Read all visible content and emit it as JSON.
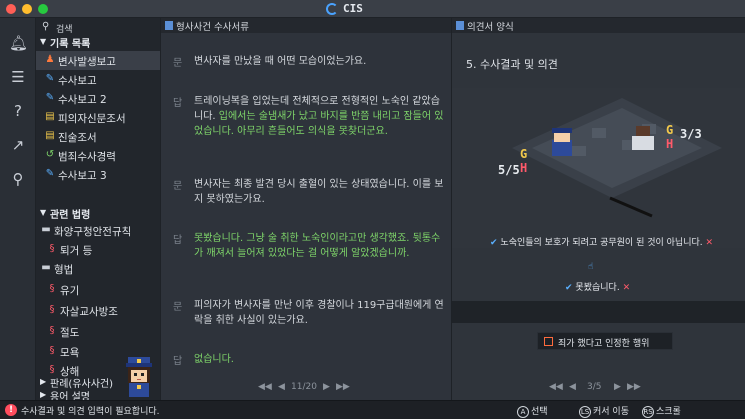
{
  "window": {
    "title": "CIS"
  },
  "search": {
    "label": "검색"
  },
  "nav": {
    "section1": "기록 목록",
    "records": [
      {
        "label": "변사발생보고",
        "icon": "person-red-icon"
      },
      {
        "label": "수사보고",
        "icon": "pen-icon"
      },
      {
        "label": "수사보고 2",
        "icon": "pen-icon"
      },
      {
        "label": "피의자신문조서",
        "icon": "document-yellow-icon"
      },
      {
        "label": "진술조서",
        "icon": "document-yellow-icon"
      },
      {
        "label": "범죄수사경력",
        "icon": "history-green-icon"
      },
      {
        "label": "수사보고 3",
        "icon": "pen-icon"
      }
    ],
    "section2": "관련 법령",
    "laws": [
      {
        "label": "화양구청안전규칙",
        "icon": "folder-icon"
      },
      {
        "label": "퇴거 등",
        "icon": "section-icon"
      },
      {
        "label": "형법",
        "icon": "folder-icon"
      },
      {
        "label": "유기",
        "icon": "section-icon"
      },
      {
        "label": "자살교사방조",
        "icon": "section-icon"
      },
      {
        "label": "절도",
        "icon": "section-icon"
      },
      {
        "label": "모욕",
        "icon": "section-icon"
      },
      {
        "label": "상해",
        "icon": "section-icon"
      }
    ],
    "section3": "판례(유사사건)",
    "section4": "용어 설명"
  },
  "middle": {
    "header": "형사사건 수사서류",
    "qa": [
      {
        "mark": "문",
        "text": "변사자를 만났을 때 어떤 모습이었는가요.",
        "green": ""
      },
      {
        "mark": "답",
        "text": "트레이닝복을 입었는데 전체적으로 전형적인 노숙인 같았습니다.",
        "green": "입에서는 술냄새가 났고 바지를 반쯤 내리고 잠들어 있었습니다. 아무리 흔들어도 의식을 못찾더군요."
      },
      {
        "mark": "문",
        "text": "변사자는 최종 발견 당시 출혈이 있는 상태였습니다. 이를 보지 못하였는가요.",
        "green": ""
      },
      {
        "mark": "답",
        "text": "",
        "green": "못봤습니다. 그냥 술 취한 노숙인이라고만 생각했죠. 뒷통수가 깨져서 늘어져 있었다는 걸 어떻게 알았겠습니까."
      },
      {
        "mark": "문",
        "text": "피의자가 변사자를 만난 이후 경찰이나 119구급대원에게 연락을 취한 사실이 있는가요.",
        "green": ""
      },
      {
        "mark": "답",
        "text": "",
        "green": "없습니다."
      }
    ],
    "pager": {
      "page": "11/20"
    }
  },
  "right": {
    "header": "의견서 양식",
    "section_title": "5. 수사결과 및 의견",
    "option1": "노숙인들의 보호가 되려고 공무원이 된 것이 아닙니다.",
    "option2": "못봤습니다.",
    "result": "죄가 했다고 인정한 행위",
    "pager": {
      "page": "3/5"
    }
  },
  "status": {
    "message": "수사결과 및 의견 입력이 필요합니다.",
    "hints": [
      {
        "key": "A",
        "label": "선택"
      },
      {
        "key": "LS",
        "label": "커서 이동"
      },
      {
        "key": "RS",
        "label": "스크롤"
      }
    ]
  },
  "colors": {
    "accent": "#4aa3ff",
    "green_text": "#7fd66a",
    "warn": "#ff4d5e"
  }
}
